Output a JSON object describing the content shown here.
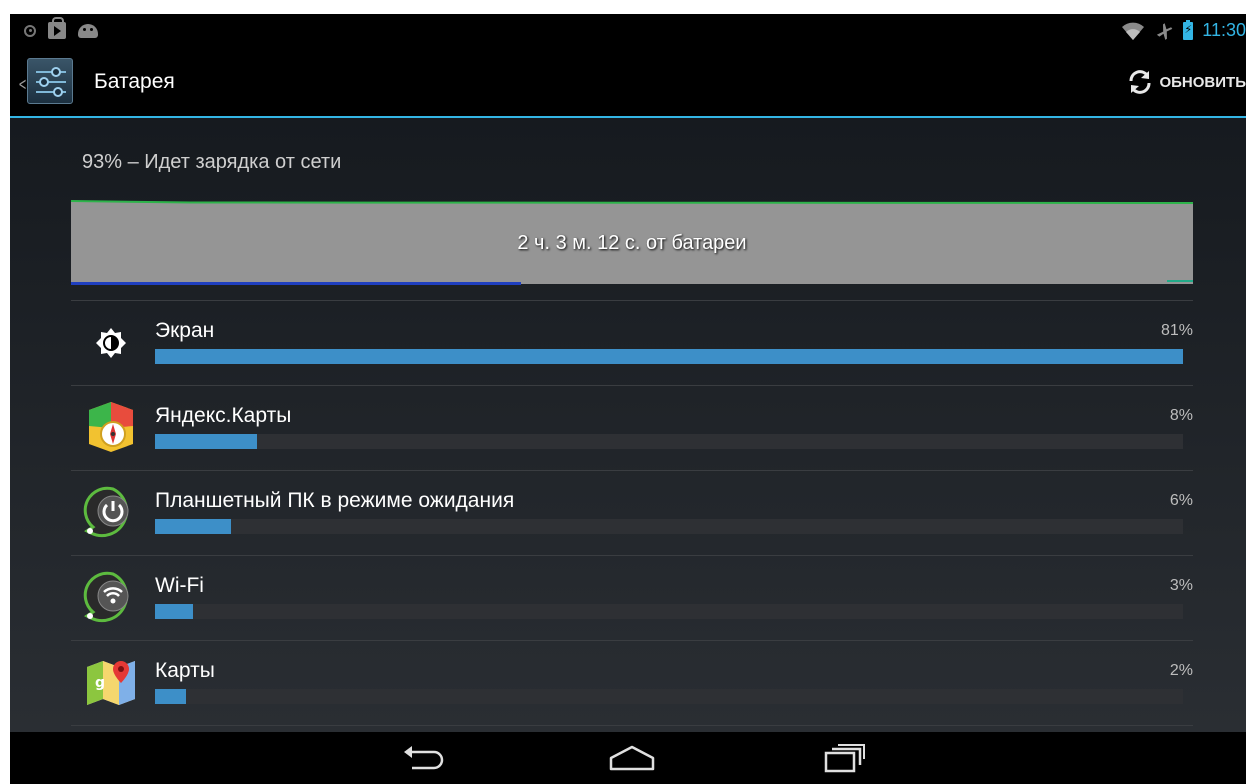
{
  "status_bar": {
    "time": "11:30",
    "icons": [
      "notification-dot-icon",
      "play-store-icon",
      "android-icon",
      "wifi-icon",
      "airplane-mode-icon",
      "battery-charging-icon"
    ]
  },
  "action_bar": {
    "title": "Батарея",
    "refresh_label": "ОБНОВИТЬ",
    "icon": "settings-sliders-icon"
  },
  "battery": {
    "summary": "93% – Идет зарядка от сети",
    "graph_label": "2 ч. 3 м. 12 с. от батареи"
  },
  "usage_list": [
    {
      "name": "Экран",
      "percent_label": "81%",
      "percent": 81,
      "icon": "brightness-icon"
    },
    {
      "name": "Яндекс.Карты",
      "percent_label": "8%",
      "percent": 8,
      "icon": "yandex-maps-icon"
    },
    {
      "name": "Планшетный ПК в режиме ожидания",
      "percent_label": "6%",
      "percent": 6,
      "icon": "standby-power-icon"
    },
    {
      "name": "Wi-Fi",
      "percent_label": "3%",
      "percent": 3,
      "icon": "wifi-icon"
    },
    {
      "name": "Карты",
      "percent_label": "2%",
      "percent": 2,
      "icon": "google-maps-icon"
    }
  ],
  "nav_bar": {
    "buttons": [
      "back-icon",
      "home-icon",
      "recents-icon"
    ]
  },
  "colors": {
    "accent": "#33b5e5",
    "usage_bar": "#3d8fc8",
    "graph_bg": "#959595",
    "graph_line": "#2db34a"
  }
}
